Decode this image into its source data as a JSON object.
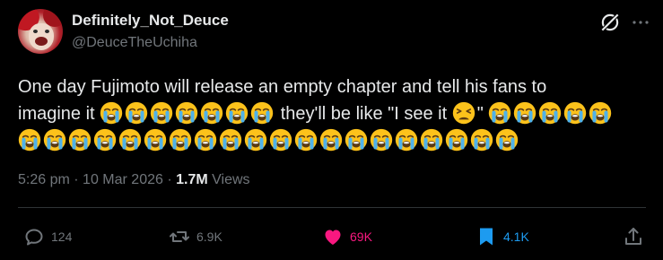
{
  "author": {
    "display_name": "Definitely_Not_Deuce",
    "handle": "@DeuceTheUchiha"
  },
  "tweet": {
    "line1": "One day Fujimoto will release an empty chapter and tell his fans to",
    "line2_a": "imagine it",
    "line2_b": "they'll be like \"I see it",
    "line2_c": "\""
  },
  "meta": {
    "time": "5:26 pm",
    "date": "10 Mar 2026",
    "separator": "·",
    "views_count": "1.7M",
    "views_label": "Views"
  },
  "actions": {
    "replies": "124",
    "reposts": "6.9K",
    "likes": "69K",
    "bookmarks": "4.1K"
  },
  "icons": {
    "crying": "loudly-crying-face-emoji",
    "tired": "tired-face-emoji"
  },
  "colors": {
    "background": "#000000",
    "text": "#e7e9ea",
    "muted": "#71767b",
    "like": "#f91880",
    "bookmark": "#1d9bf0"
  }
}
